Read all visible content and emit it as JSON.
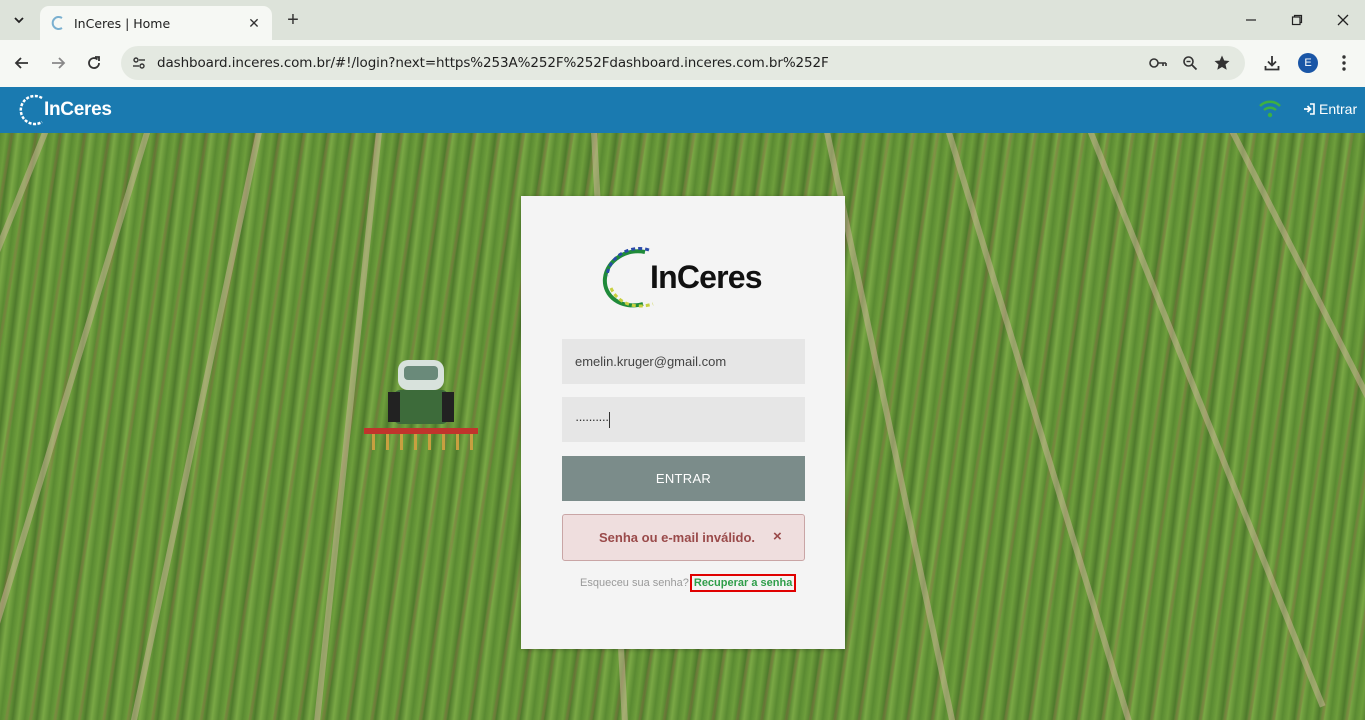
{
  "browser": {
    "tab_title": "InCeres | Home",
    "url": "dashboard.inceres.com.br/#!/login?next=https%253A%252F%252Fdashboard.inceres.com.br%252F",
    "profile_initial": "E"
  },
  "header": {
    "logo_text": "InCeres",
    "login_label": "Entrar"
  },
  "login_card": {
    "logo_text": "InCeres",
    "email_value": "emelin.kruger@gmail.com",
    "password_value": "··········",
    "submit_label": "ENTRAR",
    "error_message": "Senha ou e-mail inválido.",
    "error_close": "×",
    "forgot_text": "Esqueceu sua senha?",
    "recover_link": "Recuperar a senha"
  },
  "colors": {
    "header_bg": "#1a7ab0",
    "button_bg": "#7b8c8a",
    "link_green": "#2f9e4a",
    "error_text": "#9a4a4a"
  }
}
